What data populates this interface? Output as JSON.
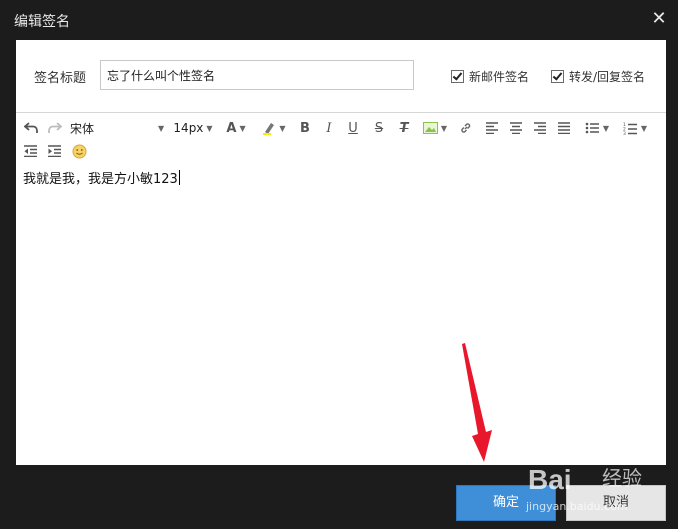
{
  "dialog": {
    "title": "编辑签名",
    "close_icon": "close-icon"
  },
  "form": {
    "title_label": "签名标题",
    "title_value": "忘了什么叫个性签名",
    "checkbox_new_mail": "新邮件签名",
    "checkbox_forward_reply": "转发/回复签名",
    "new_mail_checked": true,
    "forward_reply_checked": true
  },
  "toolbar": {
    "font_family": "宋体",
    "font_size": "14px",
    "font_color_letter": "A",
    "bold": "B",
    "italic": "I",
    "underline": "U",
    "strike": "S",
    "clear_format": "T",
    "highlight_color": "#f3f000",
    "image_color": "#8bc34a"
  },
  "editor": {
    "content": "我就是我，我是方小敏123"
  },
  "buttons": {
    "ok": "确定",
    "cancel": "取消"
  },
  "watermark": {
    "logo": "Bai",
    "logo_suffix": "经验",
    "url": "jingyan.baidu.com"
  },
  "colors": {
    "primary": "#3e8ed8",
    "background": "#1c1c1c",
    "arrow": "#e8172c"
  }
}
